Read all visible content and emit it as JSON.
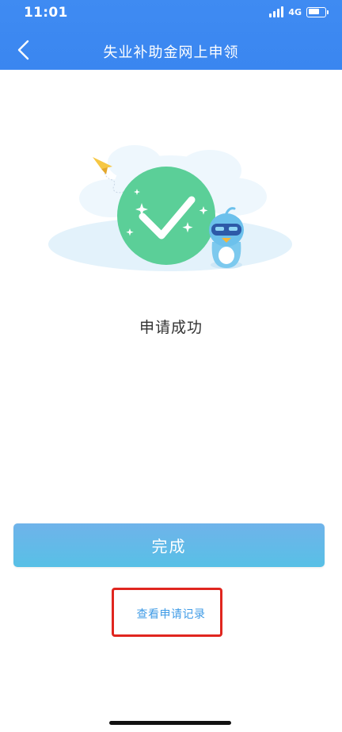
{
  "status_bar": {
    "time": "11:01",
    "network": "4G"
  },
  "nav": {
    "title": "失业补助金网上申领",
    "back_icon": "chevron-left-icon"
  },
  "result": {
    "message": "申请成功",
    "icon": "check-circle-icon"
  },
  "actions": {
    "done_label": "完成",
    "record_link": "查看申请记录"
  },
  "colors": {
    "header": "#3a86f0",
    "done_button": "#64b8e8",
    "success_green": "#5bcf98",
    "link": "#3f9be6",
    "highlight_border": "#e0261f"
  }
}
